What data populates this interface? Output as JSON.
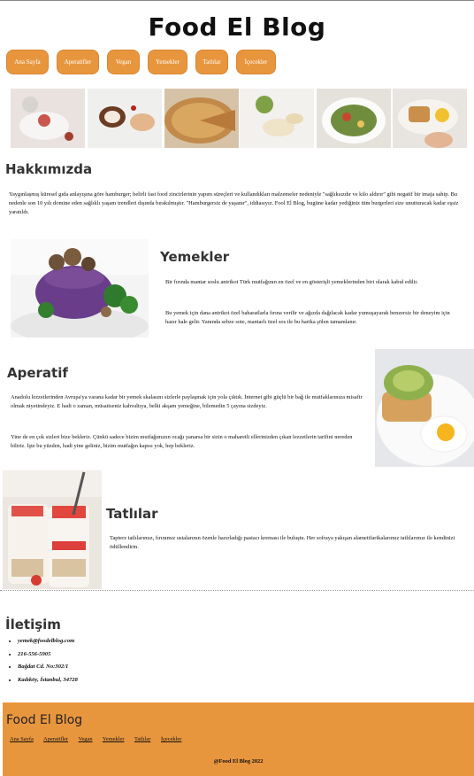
{
  "site_title": "Food El Blog",
  "nav": [
    "Ana Sayfa",
    "Aperatifler",
    "Vegan",
    "Yemekler",
    "Tatlılar",
    "İçecekler"
  ],
  "about": {
    "title": "Hakkımızda",
    "text": "Yaygınlaşmış küresel gıda anlayışına göre hamburger; belirli fast food zincirlerinin yapım süreçleri ve kullandıkları malzemeler nedeniyle \"sağlıksızdır ve kilo aldırır\" gibi negatif bir imaja sahip. Bu nedenle son 10 yılı domine eden sağlıklı yaşam trendleri dışında bırakılmıştır. \"Hamburgersiz de yaşanır\", iddiasıyız. Fool El Blog, bugüne kadar yediğiniz tüm burgerleri size unutturacak kadar eşsiz yaratıldı."
  },
  "yemekler": {
    "title": "Yemekler",
    "p1": "Bir fırında mantar soslu antrikot Türk mutfağının en özel ve en gösterişli yemeklerinden biri olarak kabul edilir.",
    "p2": "Bu yemek için dana antrikot özel baharatlarla fırına verilir ve ağızda dağılacak kadar yumuşayarak benzersiz bir deneyim için hazır hale gelir. Yanında sebze sote, mantarlı özel sos ile bu harika şölen tamamlanır."
  },
  "aperatif": {
    "title": "Aperatif",
    "p1": "Anadolu lezzetlerinden Avrupa'ya varana kadar bir yemek skalasını sizlerle paylaşmak için yola çıktık. İnternet gibi güçlü bir bağ ile mutfaklarınıza misafir olmak niyetindeyiz. E hadi o zaman, müsaitseniz kahvaltıya, belki akşam yemeğine, bilemedin 5 çayına sizdeyiz.",
    "p2": "Yine de en çok sizleri bize bekleriz. Çünkü sadece bizim mutfağımızın ocağı yanarsa bir sizin o maharetli ellerinizden çıkan lezzetlerin tarifini nereden biliriz. İşte bu yüzden, hadi yine geliniz, bizim mutfağın kapısı yok, hep bekleriz."
  },
  "tatlilar": {
    "title": "Tatlılar",
    "p1": "Tapterz tatlılarımız, fırınımız ustalarının özenle hazırladığı pastacı kreması ile buluştu. Her sofraya yakışan alametifarikalarımız tatlılarımız ile kendinizi ödüllendirin."
  },
  "contact": {
    "title": "İletişim",
    "items": [
      "yemek@foodelblog.com",
      "216-556-5905",
      "Bağdat Cd. No:302/1",
      "Kadıköy, İstanbul, 34728"
    ]
  },
  "footer": {
    "title": "Food El Blog",
    "links": [
      "Ana Sayfa",
      "Aperatifler",
      "Vegan",
      "Yemekler",
      "Tatlılar",
      "İçecekler"
    ],
    "copyright": "@Food El Blog 2022"
  },
  "colors": {
    "accent": "#e8963e"
  }
}
